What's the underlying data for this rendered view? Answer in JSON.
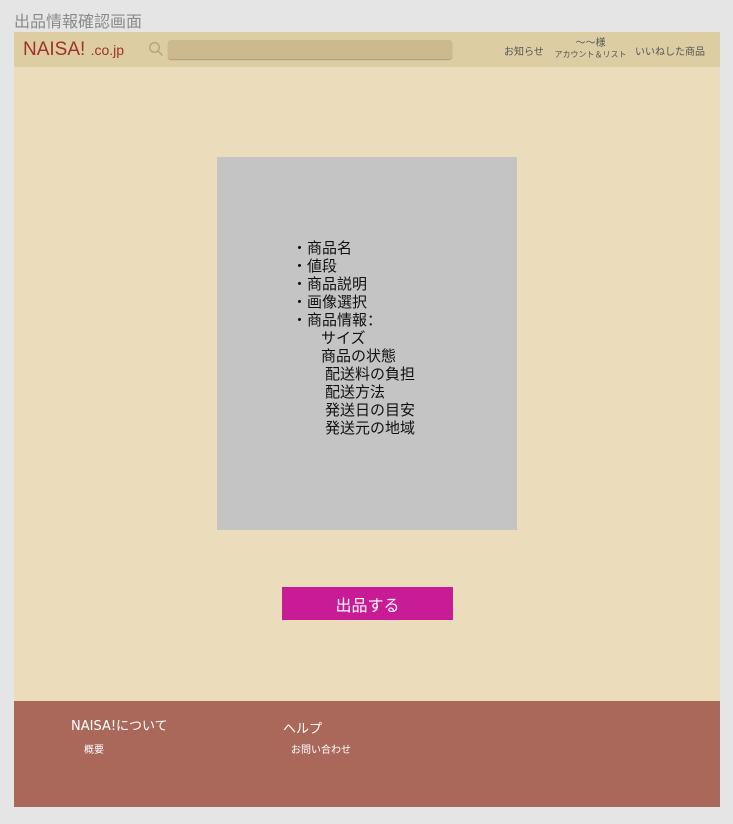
{
  "page_title": "出品情報確認画面",
  "header": {
    "logo_main": "NAISA! ",
    "logo_suffix": ".co.jp",
    "search": {
      "value": "",
      "placeholder": ""
    },
    "nav": {
      "notifications": "お知らせ",
      "account_name": "〜〜様",
      "account_sub": "アカウント＆リスト",
      "liked_items": "いいねした商品"
    }
  },
  "listing_info": {
    "items": [
      "・商品名",
      "・値段",
      "・商品説明",
      "・画像選択",
      "・商品情報："
    ],
    "details_group1": [
      "サイズ",
      "商品の状態"
    ],
    "details_group2": [
      "配送料の負担",
      "配送方法",
      "発送日の目安",
      "発送元の地域"
    ]
  },
  "submit_label": "出品する",
  "footer": {
    "about_heading": "NAISA!について",
    "about_link": "概要",
    "help_heading": "ヘルプ",
    "help_link": "お問い合わせ"
  },
  "colors": {
    "background": "#ebddbb",
    "header": "#dccda2",
    "brand": "#a0322e",
    "accent_button": "#c71c96",
    "footer": "#a9685a"
  }
}
